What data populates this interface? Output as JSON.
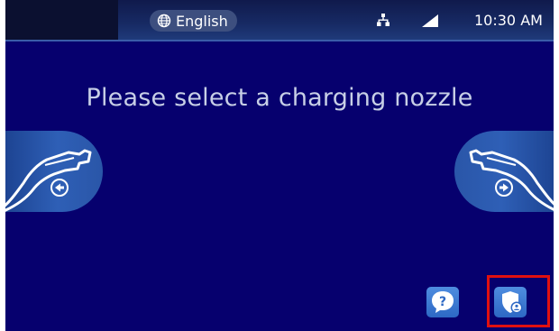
{
  "status_bar": {
    "language_label": "English",
    "language_icon": "globe-icon",
    "network_icon": "network-icon",
    "signal_icon": "cellular-signal-icon",
    "time": "10:30 AM"
  },
  "main": {
    "prompt": "Please select a charging nozzle",
    "nozzles": [
      {
        "side": "left",
        "icon": "charging-nozzle-icon",
        "direction_icon": "arrow-left-circle-icon"
      },
      {
        "side": "right",
        "icon": "charging-nozzle-icon",
        "direction_icon": "arrow-right-circle-icon"
      }
    ]
  },
  "footer": {
    "help_icon": "question-icon",
    "admin_icon": "shield-user-icon"
  },
  "colors": {
    "background": "#06006e",
    "status_bar": "#172a64",
    "button": "#3f7bd6",
    "highlight": "#e01010",
    "prompt_text": "#c7cfe6"
  }
}
